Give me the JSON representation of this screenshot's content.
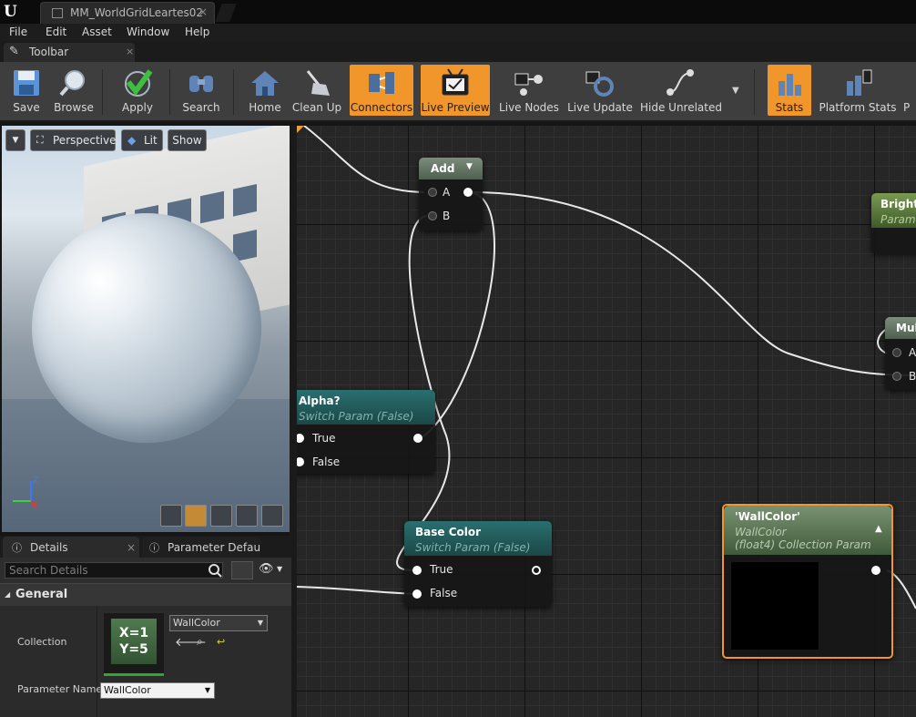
{
  "window": {
    "tab_title": "MM_WorldGridLeartes02",
    "tab_close": "×"
  },
  "menu": [
    "File",
    "Edit",
    "Asset",
    "Window",
    "Help"
  ],
  "toolbar_tab": {
    "label": "Toolbar",
    "close": "×"
  },
  "toolbar": {
    "buttons": [
      {
        "label": "Save",
        "icon": "save-icon",
        "active": false
      },
      {
        "label": "Browse",
        "icon": "browse-icon",
        "active": false
      },
      {
        "label": "Apply",
        "icon": "checkmark-icon",
        "active": false
      },
      {
        "label": "Search",
        "icon": "binoculars-icon",
        "active": false
      },
      {
        "label": "Home",
        "icon": "home-icon",
        "active": false
      },
      {
        "label": "Clean Up",
        "icon": "broom-icon",
        "active": false
      },
      {
        "label": "Connectors",
        "icon": "connectors-icon",
        "active": true
      },
      {
        "label": "Live Preview",
        "icon": "tv-icon",
        "active": true
      },
      {
        "label": "Live Nodes",
        "icon": "live-nodes-icon",
        "active": false
      },
      {
        "label": "Live Update",
        "icon": "live-update-icon",
        "active": false
      },
      {
        "label": "Hide Unrelated",
        "icon": "hide-unrelated-icon",
        "active": false
      },
      {
        "label": "Stats",
        "icon": "stats-icon",
        "active": true
      },
      {
        "label": "Platform Stats",
        "icon": "platform-stats-icon",
        "active": false
      },
      {
        "label": "P",
        "icon": "overflow-icon",
        "active": false
      }
    ],
    "accent": "#f0962a"
  },
  "viewport": {
    "perspective": "Perspective",
    "lit": "Lit",
    "show": "Show",
    "axis_z": "Z",
    "axis_x": "X"
  },
  "details": {
    "tabs": [
      {
        "label": "Details",
        "close": "×"
      },
      {
        "label": "Parameter Defaults"
      }
    ],
    "search_placeholder": "Search Details",
    "section": "General",
    "collection_label": "Collection",
    "collection_value": "WallColor",
    "thumb_line1": "X=1",
    "thumb_line2": "Y=5",
    "param_name_label": "Parameter Name",
    "param_name_value": "WallColor"
  },
  "graph": {
    "add_node": {
      "title": "Add",
      "pin_a": "A",
      "pin_b": "B"
    },
    "bright_node": {
      "title": "Bright",
      "subtitle": "Param"
    },
    "mul_node": {
      "title": "Mul",
      "pin_a": "A",
      "pin_b": "B"
    },
    "alpha_node": {
      "title": "Alpha?",
      "subtitle": "Switch Param (False)",
      "pin_true": "True",
      "pin_false": "False"
    },
    "base_node": {
      "title": "Base Color",
      "subtitle": "Switch Param (False)",
      "pin_true": "True",
      "pin_false": "False"
    },
    "wall_node": {
      "title": "'WallColor'",
      "subtitle1": "WallColor",
      "subtitle2": "(float4) Collection Param"
    }
  }
}
